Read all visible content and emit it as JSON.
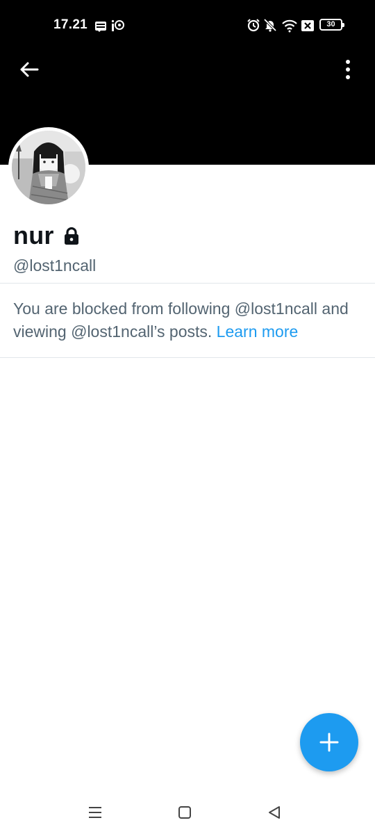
{
  "status_bar": {
    "time": "17.21",
    "battery": "30",
    "icons": [
      "webtoon-icon",
      "app-notification-icon",
      "alarm-icon",
      "bell-muted-icon",
      "wifi-icon",
      "sim-off-icon",
      "battery-icon"
    ]
  },
  "nav": {
    "back_icon": "arrow-left-icon",
    "more_icon": "more-vertical-icon"
  },
  "profile": {
    "name": "nur",
    "handle": "@lost1ncall",
    "protected_icon": "lock-icon"
  },
  "notice": {
    "text": "You are blocked from following @lost1ncall and viewing @lost1ncall’s posts. ",
    "link_label": "Learn more"
  },
  "fab": {
    "icon": "plus-icon"
  },
  "system_nav": {
    "icons": [
      "menu-icon",
      "home-icon",
      "back-triangle-icon"
    ]
  },
  "colors": {
    "banner": "#000000",
    "accent": "#1d9bf0",
    "secondary_text": "#536471",
    "primary_text": "#0f1419"
  }
}
